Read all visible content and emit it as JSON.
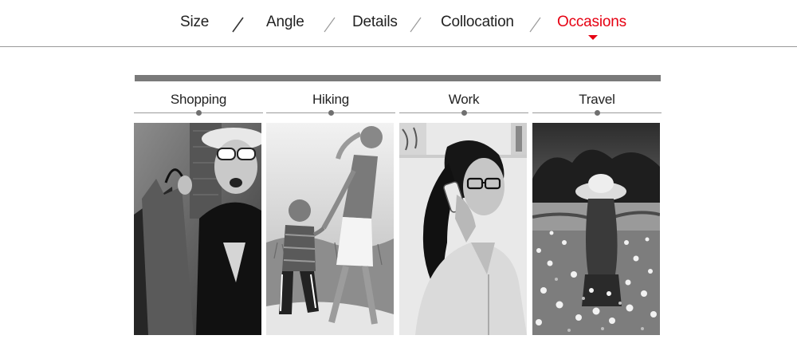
{
  "tabs": [
    {
      "label": "Size",
      "active": false
    },
    {
      "label": "Angle",
      "active": false
    },
    {
      "label": "Details",
      "active": false
    },
    {
      "label": "Collocation",
      "active": false
    },
    {
      "label": "Occasions",
      "active": true
    }
  ],
  "colors": {
    "active_tab": "#e60012",
    "text": "#222222",
    "rule": "#9a9a9a",
    "top_bar": "#7a7a7a"
  },
  "occasions": [
    {
      "title": "Shopping",
      "photo_icon": "shopping-woman-photo"
    },
    {
      "title": "Hiking",
      "photo_icon": "hiking-mother-child-photo"
    },
    {
      "title": "Work",
      "photo_icon": "office-woman-phone-photo"
    },
    {
      "title": "Travel",
      "photo_icon": "flower-field-girl-photo"
    }
  ]
}
